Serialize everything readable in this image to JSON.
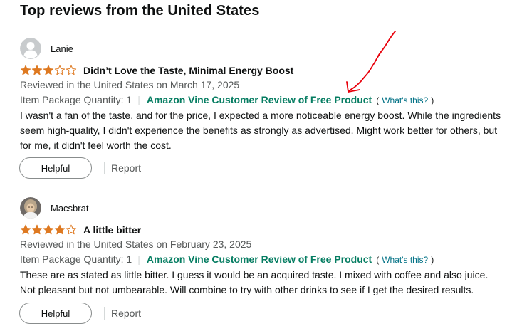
{
  "section": {
    "heading": "Top reviews from the United States"
  },
  "colors": {
    "star": "#de7921",
    "vine": "#067d62",
    "link": "#007185",
    "annotation": "#e8000b"
  },
  "reviews": [
    {
      "reviewer": "Lanie",
      "avatar_icon": "default-profile-icon",
      "rating": 3,
      "rating_max": 5,
      "title": "Didn’t Love the Taste, Minimal Energy Boost",
      "date_line": "Reviewed in the United States on March 17, 2025",
      "package_quantity": "Item Package Quantity: 1",
      "separator": "|",
      "vine_label": "Amazon Vine Customer Review of Free Product",
      "paren_open": "(",
      "whats_this": "What's this?",
      "paren_close": ")",
      "body": "I wasn't a fan of the taste, and for the price, I expected a more noticeable energy boost. While the ingredients seem high-quality, I didn't experience the benefits as strongly as advertised. Might work better for others, but for me, it didn't feel worth the cost.",
      "helpful_label": "Helpful",
      "report_label": "Report"
    },
    {
      "reviewer": "Macsbrat",
      "avatar_icon": "photo-avatar-icon",
      "rating": 4,
      "rating_max": 5,
      "title": "A little bitter",
      "date_line": "Reviewed in the United States on February 23, 2025",
      "package_quantity": "Item Package Quantity: 1",
      "separator": "|",
      "vine_label": "Amazon Vine Customer Review of Free Product",
      "paren_open": "(",
      "whats_this": "What's this?",
      "paren_close": ")",
      "body": "These are as stated as little bitter. I guess it would be an acquired taste. I mixed with coffee and also juice. Not pleasant but not umbearable. Will combine to try with other drinks to see if I get the desired results.",
      "helpful_label": "Helpful",
      "report_label": "Report"
    }
  ]
}
